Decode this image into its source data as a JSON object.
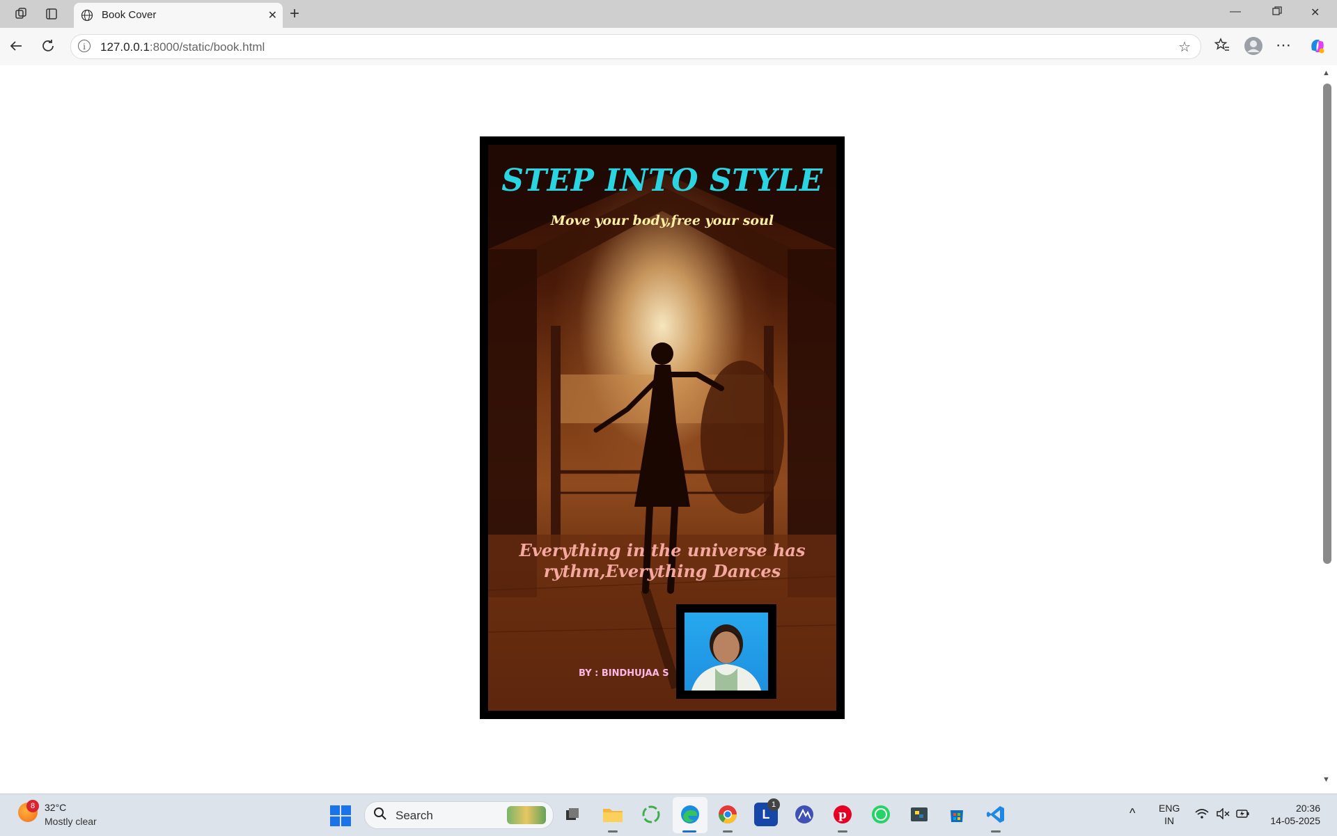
{
  "browser": {
    "tab_title": "Book Cover",
    "url_host": "127.0.0.1",
    "url_rest": ":8000/static/book.html"
  },
  "cover": {
    "title": "STEP INTO STYLE",
    "subtitle": "Move your body,free your soul",
    "quote": "Everything in the universe has rythm,Everything Dances",
    "author": "BY : BINDHUJAA S"
  },
  "taskbar": {
    "weather_badge": "8",
    "temperature": "32°C",
    "condition": "Mostly clear",
    "search_label": "Search",
    "notification_badge": "1",
    "language_top": "ENG",
    "language_bottom": "IN",
    "time": "20:36",
    "date": "14-05-2025"
  },
  "colors": {
    "title": "#2ad4e0",
    "subtitle": "#fff0a6",
    "quote": "#f4a8a0",
    "author": "#ffb6e8"
  }
}
